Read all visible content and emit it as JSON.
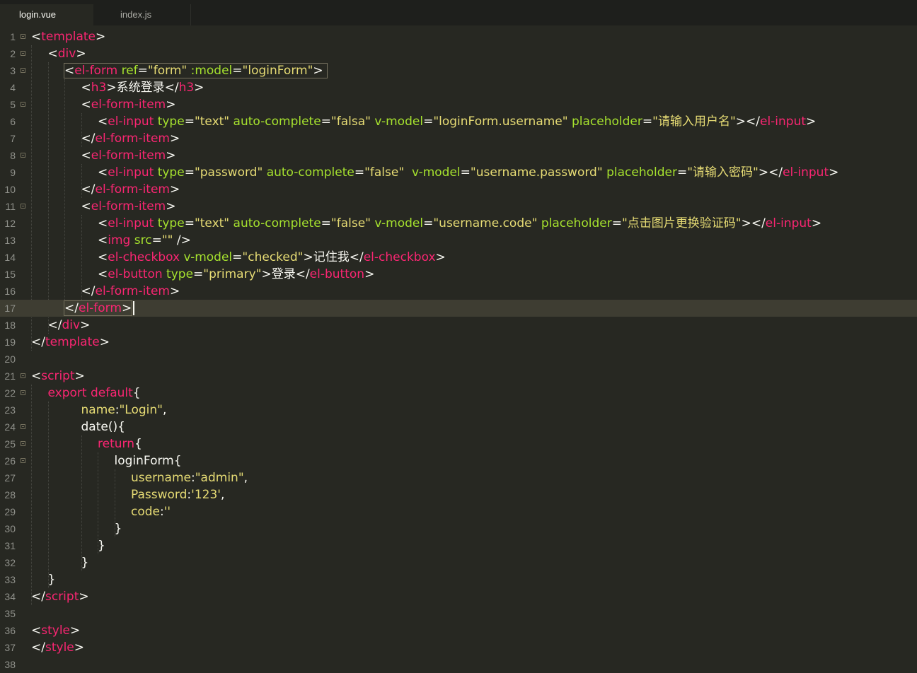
{
  "tabs": [
    {
      "label": "login.vue",
      "active": true
    },
    {
      "label": "index.js",
      "active": false
    }
  ],
  "colors": {
    "background": "#272822",
    "tag": "#f92672",
    "attribute": "#a6e22e",
    "string": "#e6db74",
    "text": "#f8f8f2",
    "line_number": "#8f908a",
    "current_line": "#3e3d32"
  },
  "cursor": {
    "line": 17
  },
  "lines": [
    {
      "n": "1",
      "fold": true,
      "indent": 0,
      "tokens": [
        [
          "p",
          "<"
        ],
        [
          "tag",
          "template"
        ],
        [
          "p",
          ">"
        ]
      ]
    },
    {
      "n": "2",
      "fold": true,
      "indent": 1,
      "tokens": [
        [
          "p",
          "<"
        ],
        [
          "tag",
          "div"
        ],
        [
          "p",
          ">"
        ]
      ]
    },
    {
      "n": "3",
      "fold": true,
      "indent": 2,
      "tokens": [
        [
          "p",
          "<"
        ],
        [
          "tag",
          "el-form"
        ],
        [
          "p",
          " "
        ],
        [
          "attr",
          "ref"
        ],
        [
          "p",
          "="
        ],
        [
          "str",
          "\"form\""
        ],
        [
          "p",
          " "
        ],
        [
          "attr",
          ":model"
        ],
        [
          "p",
          "="
        ],
        [
          "str",
          "\"loginForm\""
        ],
        [
          "p",
          ">"
        ]
      ]
    },
    {
      "n": "4",
      "fold": false,
      "indent": 3,
      "tokens": [
        [
          "p",
          "<"
        ],
        [
          "tag",
          "h3"
        ],
        [
          "p",
          ">系统登录</"
        ],
        [
          "tag",
          "h3"
        ],
        [
          "p",
          ">"
        ]
      ]
    },
    {
      "n": "5",
      "fold": true,
      "indent": 3,
      "tokens": [
        [
          "p",
          "<"
        ],
        [
          "tag",
          "el-form-item"
        ],
        [
          "p",
          ">"
        ]
      ]
    },
    {
      "n": "6",
      "fold": false,
      "indent": 4,
      "tokens": [
        [
          "p",
          "<"
        ],
        [
          "tag",
          "el-input"
        ],
        [
          "p",
          " "
        ],
        [
          "attr",
          "type"
        ],
        [
          "p",
          "="
        ],
        [
          "str",
          "\"text\""
        ],
        [
          "p",
          " "
        ],
        [
          "attr",
          "auto-complete"
        ],
        [
          "p",
          "="
        ],
        [
          "str",
          "\"falsa\""
        ],
        [
          "p",
          " "
        ],
        [
          "attr",
          "v-model"
        ],
        [
          "p",
          "="
        ],
        [
          "str",
          "\"loginForm.username\""
        ],
        [
          "p",
          " "
        ],
        [
          "attr",
          "placeholder"
        ],
        [
          "p",
          "="
        ],
        [
          "str",
          "\"请输入用户名\""
        ],
        [
          "p",
          "></"
        ],
        [
          "tag",
          "el-input"
        ],
        [
          "p",
          ">"
        ]
      ]
    },
    {
      "n": "7",
      "fold": false,
      "indent": 3,
      "tokens": [
        [
          "p",
          "</"
        ],
        [
          "tag",
          "el-form-item"
        ],
        [
          "p",
          ">"
        ]
      ]
    },
    {
      "n": "8",
      "fold": true,
      "indent": 3,
      "tokens": [
        [
          "p",
          "<"
        ],
        [
          "tag",
          "el-form-item"
        ],
        [
          "p",
          ">"
        ]
      ]
    },
    {
      "n": "9",
      "fold": false,
      "indent": 4,
      "tokens": [
        [
          "p",
          "<"
        ],
        [
          "tag",
          "el-input"
        ],
        [
          "p",
          " "
        ],
        [
          "attr",
          "type"
        ],
        [
          "p",
          "="
        ],
        [
          "str",
          "\"password\""
        ],
        [
          "p",
          " "
        ],
        [
          "attr",
          "auto-complete"
        ],
        [
          "p",
          "="
        ],
        [
          "str",
          "\"false\""
        ],
        [
          "p",
          "  "
        ],
        [
          "attr",
          "v-model"
        ],
        [
          "p",
          "="
        ],
        [
          "str",
          "\"username.password\""
        ],
        [
          "p",
          " "
        ],
        [
          "attr",
          "placeholder"
        ],
        [
          "p",
          "="
        ],
        [
          "str",
          "\"请输入密码\""
        ],
        [
          "p",
          "></"
        ],
        [
          "tag",
          "el-input"
        ],
        [
          "p",
          ">"
        ]
      ]
    },
    {
      "n": "10",
      "fold": false,
      "indent": 3,
      "tokens": [
        [
          "p",
          "</"
        ],
        [
          "tag",
          "el-form-item"
        ],
        [
          "p",
          ">"
        ]
      ]
    },
    {
      "n": "11",
      "fold": true,
      "indent": 3,
      "tokens": [
        [
          "p",
          "<"
        ],
        [
          "tag",
          "el-form-item"
        ],
        [
          "p",
          ">"
        ]
      ]
    },
    {
      "n": "12",
      "fold": false,
      "indent": 4,
      "tokens": [
        [
          "p",
          "<"
        ],
        [
          "tag",
          "el-input"
        ],
        [
          "p",
          " "
        ],
        [
          "attr",
          "type"
        ],
        [
          "p",
          "="
        ],
        [
          "str",
          "\"text\""
        ],
        [
          "p",
          " "
        ],
        [
          "attr",
          "auto-complete"
        ],
        [
          "p",
          "="
        ],
        [
          "str",
          "\"false\""
        ],
        [
          "p",
          " "
        ],
        [
          "attr",
          "v-model"
        ],
        [
          "p",
          "="
        ],
        [
          "str",
          "\"username.code\""
        ],
        [
          "p",
          " "
        ],
        [
          "attr",
          "placeholder"
        ],
        [
          "p",
          "="
        ],
        [
          "str",
          "\"点击图片更换验证码\""
        ],
        [
          "p",
          "></"
        ],
        [
          "tag",
          "el-input"
        ],
        [
          "p",
          ">"
        ]
      ]
    },
    {
      "n": "13",
      "fold": false,
      "indent": 4,
      "tokens": [
        [
          "p",
          "<"
        ],
        [
          "tag",
          "img"
        ],
        [
          "p",
          " "
        ],
        [
          "attr",
          "src"
        ],
        [
          "p",
          "="
        ],
        [
          "str",
          "\"\""
        ],
        [
          "p",
          " />"
        ]
      ]
    },
    {
      "n": "14",
      "fold": false,
      "indent": 4,
      "tokens": [
        [
          "p",
          "<"
        ],
        [
          "tag",
          "el-checkbox"
        ],
        [
          "p",
          " "
        ],
        [
          "attr",
          "v-model"
        ],
        [
          "p",
          "="
        ],
        [
          "str",
          "\"checked\""
        ],
        [
          "p",
          ">记住我</"
        ],
        [
          "tag",
          "el-checkbox"
        ],
        [
          "p",
          ">"
        ]
      ]
    },
    {
      "n": "15",
      "fold": false,
      "indent": 4,
      "tokens": [
        [
          "p",
          "<"
        ],
        [
          "tag",
          "el-button"
        ],
        [
          "p",
          " "
        ],
        [
          "attr",
          "type"
        ],
        [
          "p",
          "="
        ],
        [
          "str",
          "\"primary\""
        ],
        [
          "p",
          ">登录</"
        ],
        [
          "tag",
          "el-button"
        ],
        [
          "p",
          ">"
        ]
      ]
    },
    {
      "n": "16",
      "fold": false,
      "indent": 3,
      "tokens": [
        [
          "p",
          "</"
        ],
        [
          "tag",
          "el-form-item"
        ],
        [
          "p",
          ">"
        ]
      ]
    },
    {
      "n": "17",
      "fold": false,
      "indent": 2,
      "tokens": [
        [
          "p",
          "</"
        ],
        [
          "tag",
          "el-form"
        ],
        [
          "p",
          ">"
        ]
      ]
    },
    {
      "n": "18",
      "fold": false,
      "indent": 1,
      "tokens": [
        [
          "p",
          "</"
        ],
        [
          "tag",
          "div"
        ],
        [
          "p",
          ">"
        ]
      ]
    },
    {
      "n": "19",
      "fold": false,
      "indent": 0,
      "tokens": [
        [
          "p",
          "</"
        ],
        [
          "tag",
          "template"
        ],
        [
          "p",
          ">"
        ]
      ]
    },
    {
      "n": "20",
      "fold": false,
      "indent": 0,
      "tokens": []
    },
    {
      "n": "21",
      "fold": true,
      "indent": 0,
      "tokens": [
        [
          "p",
          "<"
        ],
        [
          "tag",
          "script"
        ],
        [
          "p",
          ">"
        ]
      ]
    },
    {
      "n": "22",
      "fold": true,
      "indent": 1,
      "tokens": [
        [
          "kw",
          "export default"
        ],
        [
          "p",
          "{"
        ]
      ]
    },
    {
      "n": "23",
      "fold": false,
      "indent": 3,
      "tokens": [
        [
          "str",
          "name"
        ],
        [
          "p",
          ":"
        ],
        [
          "str",
          "\"Login\""
        ],
        [
          "p",
          ","
        ]
      ]
    },
    {
      "n": "24",
      "fold": true,
      "indent": 3,
      "tokens": [
        [
          "p",
          "date(){"
        ]
      ]
    },
    {
      "n": "25",
      "fold": true,
      "indent": 4,
      "tokens": [
        [
          "kw",
          "return"
        ],
        [
          "p",
          "{"
        ]
      ]
    },
    {
      "n": "26",
      "fold": true,
      "indent": 5,
      "tokens": [
        [
          "p",
          "loginForm{"
        ]
      ]
    },
    {
      "n": "27",
      "fold": false,
      "indent": 6,
      "tokens": [
        [
          "str",
          "username"
        ],
        [
          "p",
          ":"
        ],
        [
          "str",
          "\"admin\""
        ],
        [
          "p",
          ","
        ]
      ]
    },
    {
      "n": "28",
      "fold": false,
      "indent": 6,
      "tokens": [
        [
          "str",
          "Password"
        ],
        [
          "p",
          ":"
        ],
        [
          "str",
          "'123'"
        ],
        [
          "p",
          ","
        ]
      ]
    },
    {
      "n": "29",
      "fold": false,
      "indent": 6,
      "tokens": [
        [
          "str",
          "code"
        ],
        [
          "p",
          ":"
        ],
        [
          "str",
          "''"
        ]
      ]
    },
    {
      "n": "30",
      "fold": false,
      "indent": 5,
      "tokens": [
        [
          "p",
          "}"
        ]
      ]
    },
    {
      "n": "31",
      "fold": false,
      "indent": 4,
      "tokens": [
        [
          "p",
          "}"
        ]
      ]
    },
    {
      "n": "32",
      "fold": false,
      "indent": 3,
      "tokens": [
        [
          "p",
          "}"
        ]
      ]
    },
    {
      "n": "33",
      "fold": false,
      "indent": 1,
      "tokens": [
        [
          "p",
          "}"
        ]
      ]
    },
    {
      "n": "34",
      "fold": false,
      "indent": 0,
      "tokens": [
        [
          "p",
          "</"
        ],
        [
          "tag",
          "script"
        ],
        [
          "p",
          ">"
        ]
      ]
    },
    {
      "n": "35",
      "fold": false,
      "indent": 0,
      "tokens": []
    },
    {
      "n": "36",
      "fold": false,
      "indent": 0,
      "tokens": [
        [
          "p",
          "<"
        ],
        [
          "tag",
          "style"
        ],
        [
          "p",
          ">"
        ]
      ]
    },
    {
      "n": "37",
      "fold": false,
      "indent": 0,
      "tokens": [
        [
          "p",
          "</"
        ],
        [
          "tag",
          "style"
        ],
        [
          "p",
          ">"
        ]
      ]
    },
    {
      "n": "38",
      "fold": false,
      "indent": 0,
      "tokens": []
    }
  ]
}
